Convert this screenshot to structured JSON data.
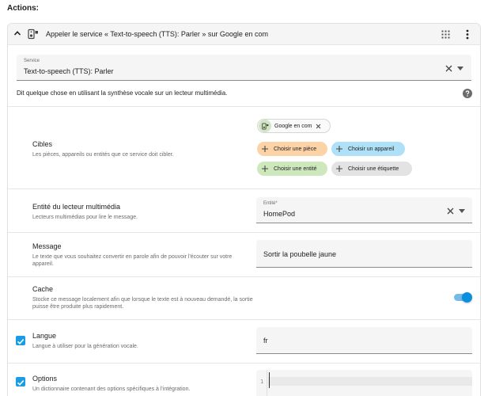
{
  "actions_label": "Actions:",
  "header": {
    "title": "Appeler le service « Text-to-speech (TTS): Parler » sur Google en com"
  },
  "service": {
    "label": "Service",
    "value": "Text-to-speech (TTS): Parler"
  },
  "description": "Dit quelque chose en utilisant la synthèse vocale sur un lecteur multimédia.",
  "targets": {
    "title": "Cibles",
    "description": "Les pièces, appareils ou entités que ce service doit cibler.",
    "entity_chip": "Google en com",
    "add_room": "Choisir une pièce",
    "add_device": "Choisir un appareil",
    "add_entity": "Choisir une entité",
    "add_label": "Choisir une étiquette"
  },
  "media_player": {
    "title": "Entité du lecteur multimédia",
    "description": "Lecteurs multimédias pour lire le message.",
    "field_label": "Entité*",
    "value": "HomePod"
  },
  "message": {
    "title": "Message",
    "description": "Le texte que vous souhaitez convertir en parole afin de pouvoir l'écouter sur votre appareil.",
    "value": "Sortir la poubelle jaune"
  },
  "cache": {
    "title": "Cache",
    "description": "Stocke ce message localement afin que lorsque le texte est à nouveau demandé, la sortie puisse être produite plus rapidement.",
    "enabled": true
  },
  "language": {
    "title": "Langue",
    "description": "Langue à utiliser pour la génération vocale.",
    "value": "fr",
    "checked": true
  },
  "options": {
    "title": "Options",
    "description": "Un dictionnaire contenant des options spécifiques à l'intégration.",
    "line_number": "1",
    "checked": true
  },
  "colors": {
    "accent": "#1a9be6",
    "chip_room": "#fbd3a6",
    "chip_device": "#aee0f7",
    "chip_entity": "#cde8bd",
    "chip_label": "#e3e3e3"
  }
}
